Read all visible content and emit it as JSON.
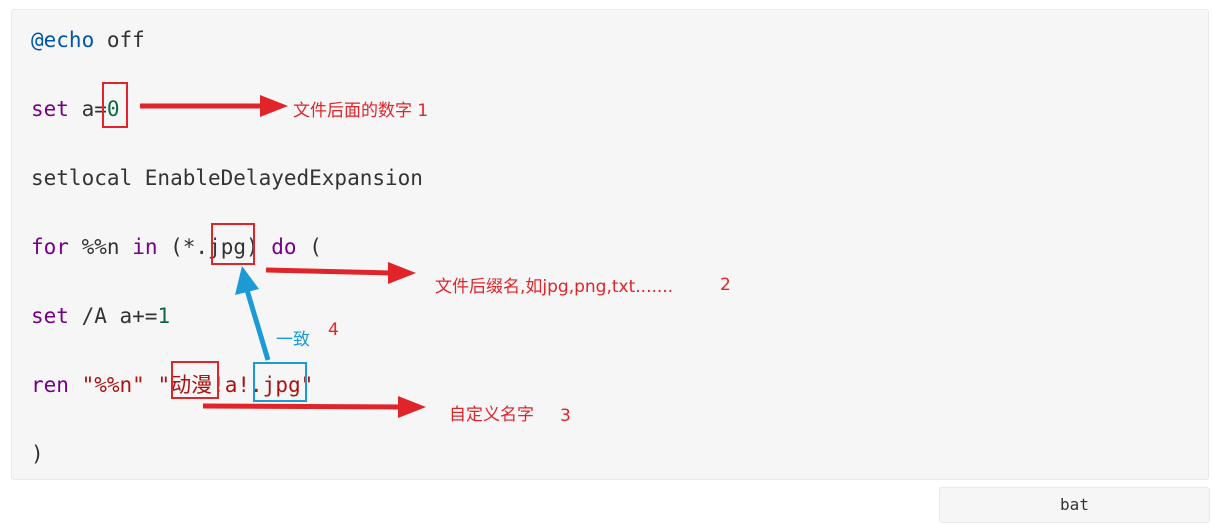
{
  "code": {
    "line1": {
      "at": "@echo",
      "rest": " off"
    },
    "line2": {
      "kw": "set",
      "rest": " a=",
      "num": "0"
    },
    "line3": {
      "text": "setlocal EnableDelayedExpansion"
    },
    "line4": {
      "kw1": "for",
      "sp1": " ",
      "var": "%%n",
      "sp2": " ",
      "kw2": "in",
      "rest": " (*.jpg) ",
      "kw3": "do",
      "tail": " ("
    },
    "line5": {
      "kw": "set",
      "rest": " /A a+=",
      "num": "1"
    },
    "line6": {
      "kw": "ren",
      "sp": " ",
      "str1": "\"%%n\"",
      "sp2": " ",
      "str2": "\"动漫!a!.jpg\""
    },
    "line7": {
      "text": ")"
    }
  },
  "annotations": {
    "note1": "文件后面的数字 1",
    "note2_text": "文件后缀名,如jpg,png,txt.......",
    "note2_num": "2",
    "note3_text": "自定义名字",
    "note3_num": "3",
    "note4_text": "一致",
    "note4_num": "4"
  },
  "language_label": "bat",
  "colors": {
    "red": "#e0242a",
    "blue": "#1b9ad6"
  }
}
